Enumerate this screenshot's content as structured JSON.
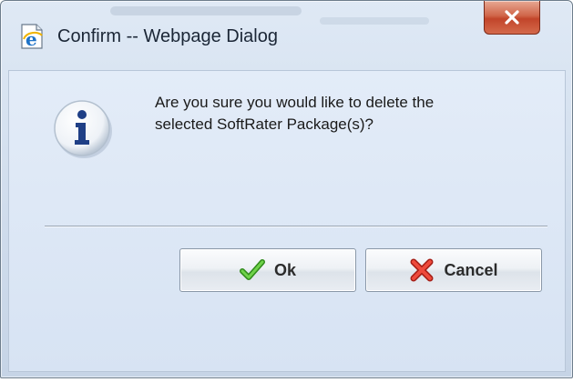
{
  "window": {
    "title": "Confirm -- Webpage Dialog",
    "title_icon": "ie-page-icon",
    "close_icon": "close-x-icon"
  },
  "dialog": {
    "icon": "information-icon",
    "message_lines": [
      "Are you sure you would like to delete the",
      "selected SoftRater Package(s)?"
    ]
  },
  "buttons": {
    "ok_label": "Ok",
    "ok_icon": "checkmark-icon",
    "cancel_label": "Cancel",
    "cancel_icon": "red-x-icon"
  },
  "colors": {
    "client_background": "#dbe6f4",
    "close_button": "#c9503a",
    "ok_check": "#4caf2b",
    "cancel_x": "#d9342a",
    "info_letter": "#1f3f86"
  }
}
